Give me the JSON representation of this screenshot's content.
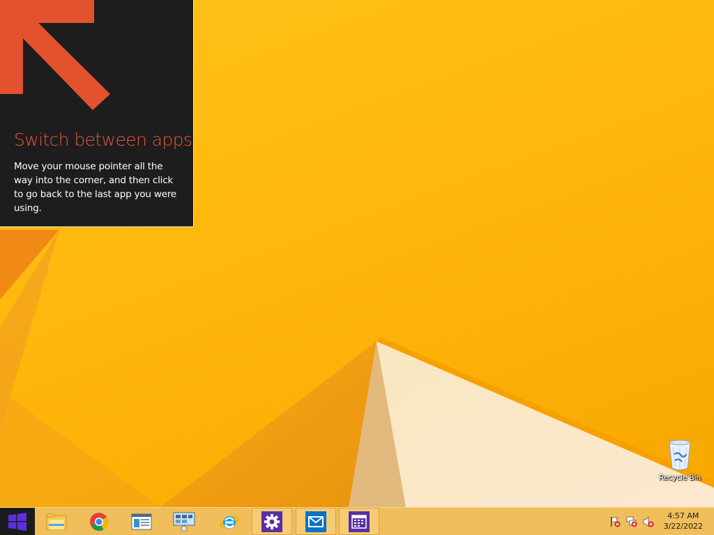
{
  "tip": {
    "title": "Switch between apps",
    "body": "Move your mouse pointer all the way into the corner, and then click to go back to the last app you were using."
  },
  "desktop": {
    "recycle_bin_label": "Recycle Bin"
  },
  "taskbar": {
    "pinned_apps": [
      {
        "name": "File Explorer",
        "icon": "file-explorer-icon",
        "active": false
      },
      {
        "name": "Google Chrome",
        "icon": "chrome-icon",
        "active": false
      },
      {
        "name": "Server Manager",
        "icon": "server-manager-icon",
        "active": false
      },
      {
        "name": "Network / Remote Desktop",
        "icon": "network-computer-icon",
        "active": false
      },
      {
        "name": "Internet Explorer",
        "icon": "internet-explorer-icon",
        "active": false
      },
      {
        "name": "Settings",
        "icon": "settings-gear-icon",
        "active": true
      },
      {
        "name": "Mail",
        "icon": "mail-icon",
        "active": true
      },
      {
        "name": "Calendar",
        "icon": "calendar-icon",
        "active": true
      }
    ],
    "tray": {
      "icons": [
        "action-center-flag-icon",
        "network-disconnected-icon",
        "volume-muted-icon"
      ],
      "time": "4:57 AM",
      "date": "3/22/2022"
    }
  },
  "colors": {
    "wallpaper_yellow": "#ffb70b",
    "tip_background": "#1d1d1d",
    "tip_accent": "#e8553a",
    "taskbar": "#f0be5a",
    "settings_tile": "#5b2ea6",
    "mail_tile": "#0a73c7",
    "calendar_tile": "#5b2ea6"
  }
}
